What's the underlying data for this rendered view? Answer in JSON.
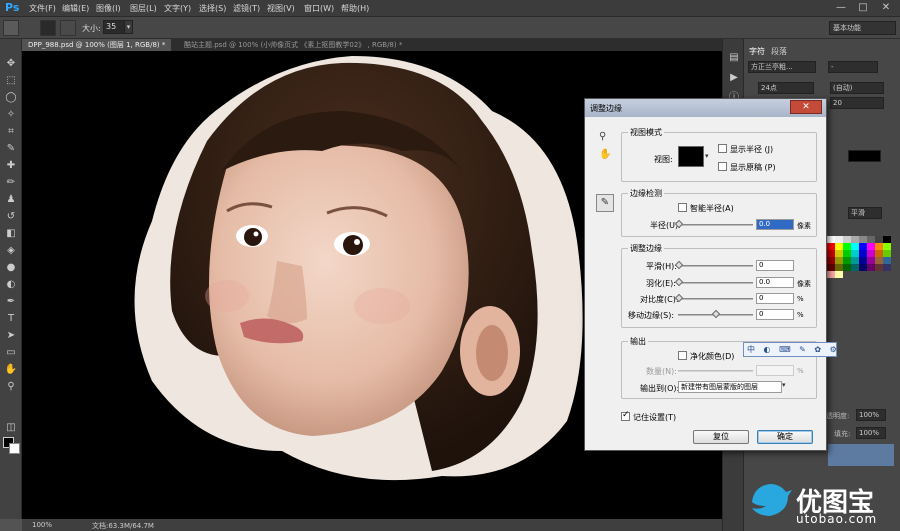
{
  "app": {
    "logo": "Ps",
    "menu": [
      "文件(F)",
      "编辑(E)",
      "图像(I)",
      "图层(L)",
      "文字(Y)",
      "选择(S)",
      "滤镜(T)",
      "视图(V)",
      "窗口(W)",
      "帮助(H)"
    ],
    "window_controls": [
      "—",
      "□",
      "✕"
    ]
  },
  "options_bar": {
    "size_label": "大小:",
    "size_value": "35",
    "workspace": "基本功能"
  },
  "tabs": {
    "active": "DPP_988.psd @ 100% (图层 1, RGB/8) *",
    "inactive": "酷站主题.psd @ 100% (小帅像页式 《素上抠图教学02》 , RGB/8) *"
  },
  "status": {
    "zoom": "100%",
    "doc": "文档:63.3M/64.7M"
  },
  "panels": {
    "tab_character": "字符",
    "tab_paragraph": "段落",
    "font_family": "方正兰亭粗...",
    "font_style": "-",
    "font_size": "24点",
    "leading": "(自动)",
    "tracking_value": "20",
    "sharp_label": "平滑",
    "opacity_label": "透明度:",
    "opacity_value": "100%",
    "fill_label": "填充:",
    "fill_value": "100%"
  },
  "dialog": {
    "title": "调整边缘",
    "close": "✕",
    "view_mode": {
      "title": "视图模式",
      "view_label": "视图:",
      "show_radius": "显示半径 (J)",
      "show_original": "显示原稿 (P)"
    },
    "edge_detection": {
      "title": "边缘检测",
      "smart_radius": "智能半径(A)",
      "radius_label": "半径(U):",
      "radius_value": "0.0",
      "radius_unit": "像素"
    },
    "adjust_edge": {
      "title": "调整边缘",
      "smooth_label": "平滑(H):",
      "smooth_value": "0",
      "feather_label": "羽化(E):",
      "feather_value": "0.0",
      "feather_unit": "像素",
      "contrast_label": "对比度(C):",
      "contrast_value": "0",
      "contrast_unit": "%",
      "shift_label": "移动边缘(S):",
      "shift_value": "0",
      "shift_unit": "%"
    },
    "output": {
      "title": "输出",
      "decontaminate": "净化颜色(D)",
      "amount_label": "数量(N):",
      "amount_unit": "%",
      "output_to_label": "输出到(O):",
      "output_to_value": "新建带有图层蒙版的图层"
    },
    "remember": "记住设置(T)",
    "cancel": "复位",
    "ok": "确定"
  },
  "ime": {
    "label": "中 ◐ ⌨ ✎ ✿ ⚙"
  },
  "watermark": {
    "text": "优图宝",
    "url": "utobao.com"
  }
}
